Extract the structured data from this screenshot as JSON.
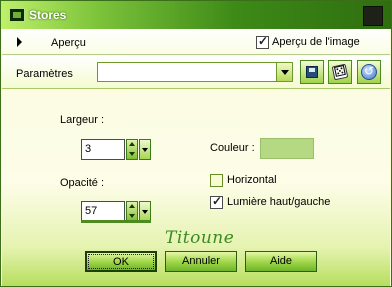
{
  "window": {
    "title": "Stores"
  },
  "preview": {
    "expander_label": "Aperçu",
    "image_preview_label": "Aperçu de l'image",
    "image_preview_checked": true
  },
  "params": {
    "label": "Paramètres",
    "value": ""
  },
  "fields": {
    "largeur_label": "Largeur :",
    "largeur_value": "3",
    "opacite_label": "Opacité :",
    "opacite_value": "57",
    "couleur_label": "Couleur :",
    "couleur_color": "#b5d983"
  },
  "options": {
    "horizontal_label": "Horizontal",
    "horizontal_checked": false,
    "lumiere_label": "Lumière haut/gauche",
    "lumiere_checked": true
  },
  "watermark": "Titoune",
  "buttons": {
    "ok": "OK",
    "cancel": "Annuler",
    "help": "Aide"
  },
  "icons": [
    "app-icon",
    "close-icon",
    "expand-arrow-icon",
    "save-preset-icon",
    "random-dice-icon",
    "reset-icon",
    "dropdown-arrow-icon",
    "spin-arrows-icon"
  ]
}
